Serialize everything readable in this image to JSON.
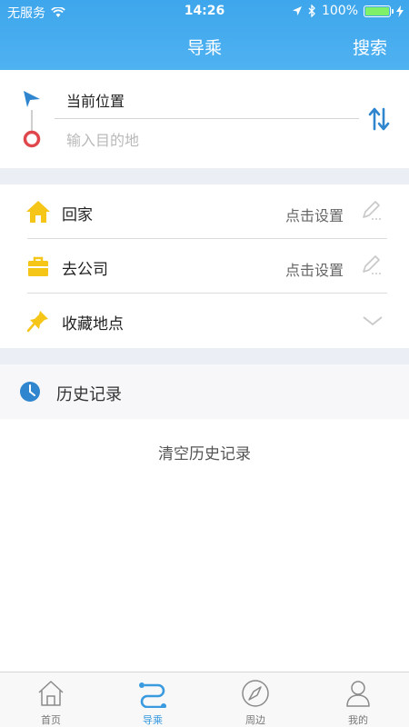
{
  "status_bar": {
    "carrier": "无服务",
    "time": "14:26",
    "battery": "100%"
  },
  "nav": {
    "title": "导乘",
    "search_label": "搜索"
  },
  "route": {
    "from_value": "当前位置",
    "to_placeholder": "输入目的地"
  },
  "shortcuts": [
    {
      "label": "回家",
      "action": "点击设置",
      "icon": "home-icon"
    },
    {
      "label": "去公司",
      "action": "点击设置",
      "icon": "briefcase-icon"
    },
    {
      "label": "收藏地点",
      "icon": "pin-icon"
    }
  ],
  "history": {
    "title": "历史记录",
    "clear_label": "清空历史记录"
  },
  "tabs": [
    {
      "label": "首页",
      "icon": "home-tab-icon",
      "active": false
    },
    {
      "label": "导乘",
      "icon": "route-tab-icon",
      "active": true
    },
    {
      "label": "周边",
      "icon": "compass-icon",
      "active": false
    },
    {
      "label": "我的",
      "icon": "user-icon",
      "active": false
    }
  ],
  "colors": {
    "header": "#4fb2f1",
    "accent": "#3a9ae0",
    "home_icon": "#f5c518",
    "end_marker": "#e0474c"
  }
}
